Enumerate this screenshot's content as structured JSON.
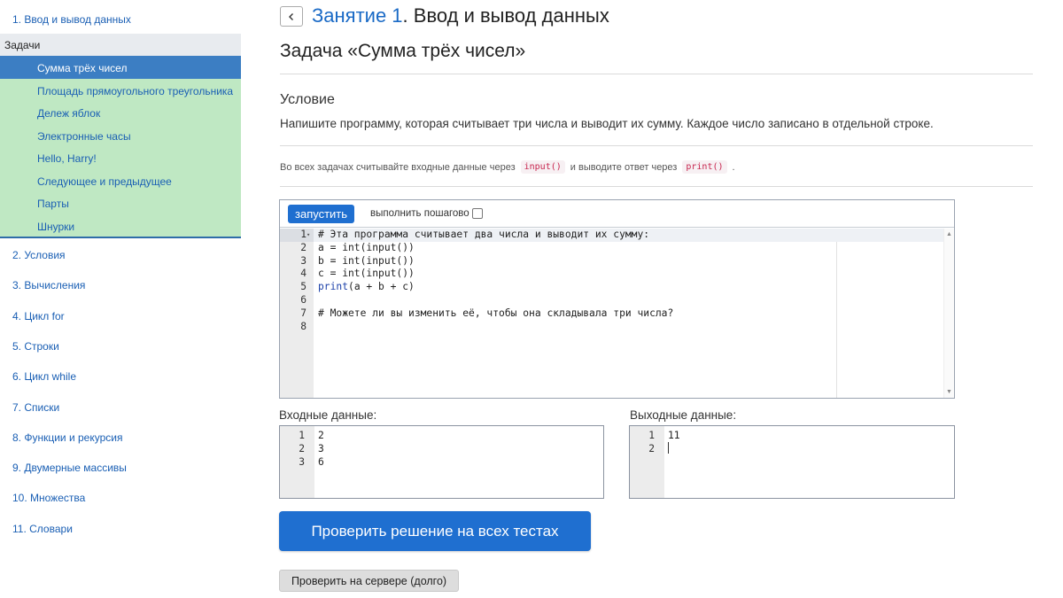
{
  "sidebar": {
    "top_link": "1. Ввод и вывод данных",
    "section_header": "Задачи",
    "tasks": [
      "Сумма трёх чисел",
      "Площадь прямоугольного треугольника",
      "Дележ яблок",
      "Электронные часы",
      "Hello, Harry!",
      "Следующее и предыдущее",
      "Парты",
      "Шнурки"
    ],
    "active_task_index": 0,
    "lessons": [
      "2. Условия",
      "3. Вычисления",
      "4. Цикл for",
      "5. Строки",
      "6. Цикл while",
      "7. Списки",
      "8. Функции и рекурсия",
      "9. Двумерные массивы",
      "10. Множества",
      "11. Словари"
    ]
  },
  "header": {
    "lesson_prefix": "Занятие 1",
    "lesson_suffix": ". Ввод и вывод данных",
    "task_title": "Задача «Сумма трёх чисел»"
  },
  "condition": {
    "label": "Условие",
    "text": "Напишите программу, которая считывает три числа и выводит их сумму. Каждое число записано в отдельной строке."
  },
  "note": {
    "part1": "Во всех задачах считывайте входные данные через",
    "code1": "input()",
    "part2": "и выводите ответ через",
    "code2": "print()",
    "part3": "."
  },
  "editor": {
    "run_label": "запустить",
    "step_label": "выполнить пошагово",
    "step_checked": false,
    "lines": [
      "# Эта программа считывает два числа и выводит их сумму:",
      "a = int(input())",
      "b = int(input())",
      "c = int(input())",
      "print(a + b + c)",
      "",
      "# Можете ли вы изменить её, чтобы она складывала три числа?",
      ""
    ],
    "active_line": 1
  },
  "input": {
    "label": "Входные данные:",
    "lines": [
      "2",
      "3",
      "6"
    ]
  },
  "output": {
    "label": "Выходные данные:",
    "lines": [
      "11",
      ""
    ]
  },
  "buttons": {
    "check_all": "Проверить решение на всех тестах",
    "check_server": "Проверить на сервере (долго)"
  },
  "colors": {
    "accent": "#1f6fd0",
    "task_list_bg": "#bfe8c3",
    "active_task_bg": "#3c7ec3",
    "comment": "#2e7d32",
    "code_chip": "#c7254e"
  }
}
